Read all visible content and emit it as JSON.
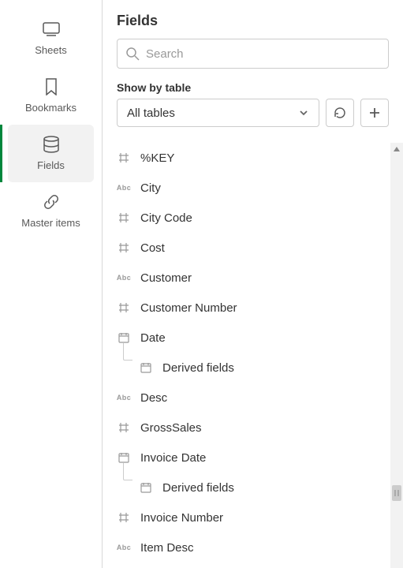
{
  "sidebar": {
    "items": [
      {
        "label": "Sheets"
      },
      {
        "label": "Bookmarks"
      },
      {
        "label": "Fields"
      },
      {
        "label": "Master items"
      }
    ]
  },
  "panel": {
    "title": "Fields",
    "search_placeholder": "Search",
    "show_by_label": "Show by table",
    "table_selected": "All tables"
  },
  "fields": [
    {
      "type": "num",
      "label": "%KEY"
    },
    {
      "type": "abc",
      "label": "City"
    },
    {
      "type": "num",
      "label": "City Code"
    },
    {
      "type": "num",
      "label": "Cost"
    },
    {
      "type": "abc",
      "label": "Customer"
    },
    {
      "type": "num",
      "label": "Customer Number"
    },
    {
      "type": "date",
      "label": "Date"
    },
    {
      "type": "date",
      "label": "Derived fields",
      "child": true
    },
    {
      "type": "abc",
      "label": "Desc"
    },
    {
      "type": "num",
      "label": "GrossSales"
    },
    {
      "type": "date",
      "label": "Invoice Date"
    },
    {
      "type": "date",
      "label": "Derived fields",
      "child": true
    },
    {
      "type": "num",
      "label": "Invoice Number"
    },
    {
      "type": "abc",
      "label": "Item Desc"
    }
  ]
}
